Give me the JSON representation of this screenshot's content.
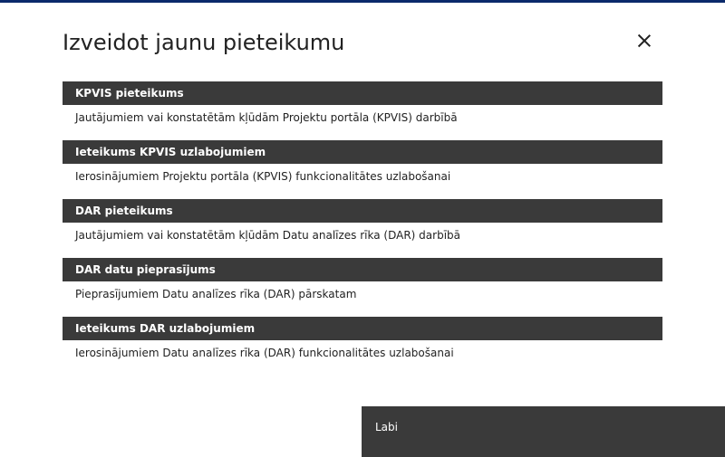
{
  "dialog": {
    "title": "Izveidot jaunu pieteikumu",
    "close_icon": "close-icon",
    "options": [
      {
        "header": "KPVIS pieteikums",
        "description": "Jautājumiem vai konstatētām kļūdām Projektu portāla (KPVIS) darbībā"
      },
      {
        "header": "Ieteikums KPVIS uzlabojumiem",
        "description": "Ierosinājumiem Projektu portāla (KPVIS) funkcionalitātes uzlabošanai"
      },
      {
        "header": "DAR pieteikums",
        "description": "Jautājumiem vai konstatētām kļūdām Datu analīzes rīka (DAR) darbībā"
      },
      {
        "header": "DAR datu pieprasījums",
        "description": "Pieprasījumiem Datu analīzes rīka (DAR) pārskatam"
      },
      {
        "header": "Ieteikums DAR uzlabojumiem",
        "description": "Ierosinājumiem Datu analīzes rīka (DAR) funkcionalitātes uzlabošanai"
      }
    ],
    "ok_label": "Labi"
  },
  "colors": {
    "top_border": "#0b2a6b",
    "header_bg": "#3a3a3a",
    "button_bg": "#3a3a3a"
  }
}
